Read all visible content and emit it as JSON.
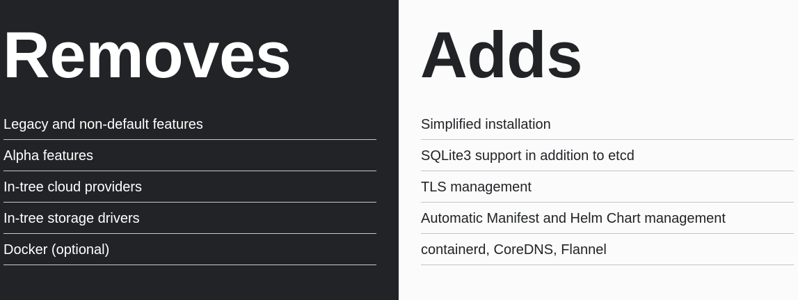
{
  "removes": {
    "title": "Removes",
    "items": [
      "Legacy and non-default features",
      "Alpha features",
      "In-tree cloud providers",
      "In-tree storage drivers",
      "Docker (optional)"
    ],
    "background": "#212326",
    "text_color": "#ffffff"
  },
  "adds": {
    "title": "Adds",
    "items": [
      "Simplified installation",
      "SQLite3 support in addition to etcd",
      "TLS management",
      "Automatic Manifest and Helm Chart management",
      "containerd, CoreDNS, Flannel"
    ],
    "background": "#fbfbfb",
    "text_color": "#212326"
  }
}
